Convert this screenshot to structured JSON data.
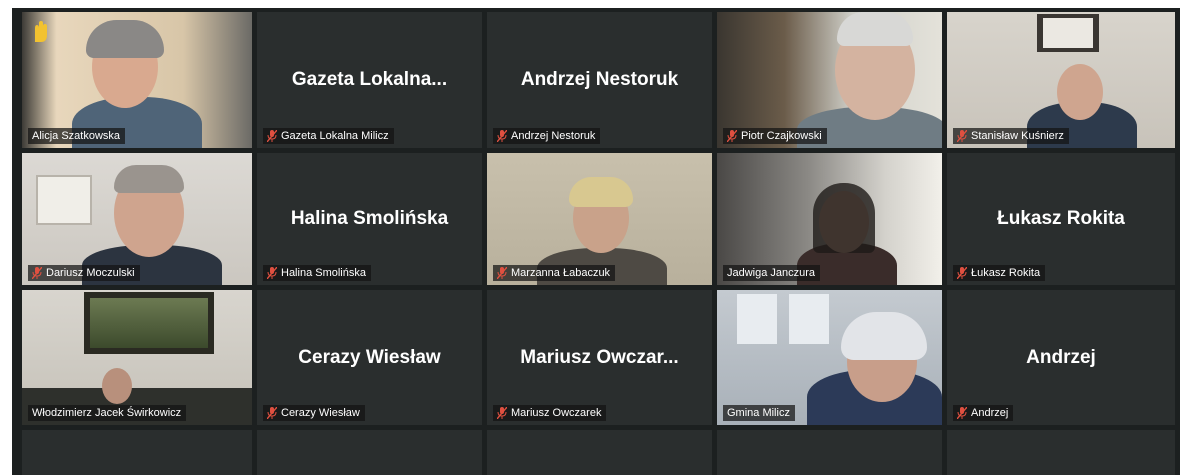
{
  "colors": {
    "tile_bg": "#2a2e2e",
    "grid_bg": "#1c2020",
    "active_border": "#d9d98a",
    "mic_muted": "#e05040",
    "hand_raise": "#f2c230"
  },
  "participants": [
    {
      "display_name": "",
      "label": "Alicja Szatkowska",
      "video": true,
      "muted": false,
      "hand_raised": true,
      "active": true
    },
    {
      "display_name": "Gazeta  Lokalna...",
      "label": "Gazeta Lokalna Milicz",
      "video": false,
      "muted": true
    },
    {
      "display_name": "Andrzej Nestoruk",
      "label": "Andrzej Nestoruk",
      "video": false,
      "muted": true
    },
    {
      "display_name": "",
      "label": "Piotr Czajkowski",
      "video": true,
      "muted": true
    },
    {
      "display_name": "",
      "label": "Stanisław Kuśnierz",
      "video": true,
      "muted": true
    },
    {
      "display_name": "",
      "label": "Dariusz Moczulski",
      "video": true,
      "muted": true
    },
    {
      "display_name": "Halina Smolińska",
      "label": "Halina Smolińska",
      "video": false,
      "muted": true
    },
    {
      "display_name": "",
      "label": "Marzanna Łabaczuk",
      "video": true,
      "muted": true
    },
    {
      "display_name": "",
      "label": "Jadwiga Janczura",
      "video": true,
      "muted": false
    },
    {
      "display_name": "Łukasz Rokita",
      "label": "Łukasz Rokita",
      "video": false,
      "muted": true
    },
    {
      "display_name": "",
      "label": "Włodzimierz Jacek Świrkowicz",
      "video": true,
      "muted": false
    },
    {
      "display_name": "Cerazy Wiesław",
      "label": "Cerazy Wiesław",
      "video": false,
      "muted": true
    },
    {
      "display_name": "Mariusz  Owczar...",
      "label": "Mariusz Owczarek",
      "video": false,
      "muted": true
    },
    {
      "display_name": "",
      "label": "Gmina Milicz",
      "video": true,
      "muted": false
    },
    {
      "display_name": "Andrzej",
      "label": "Andrzej",
      "video": false,
      "muted": true
    }
  ]
}
